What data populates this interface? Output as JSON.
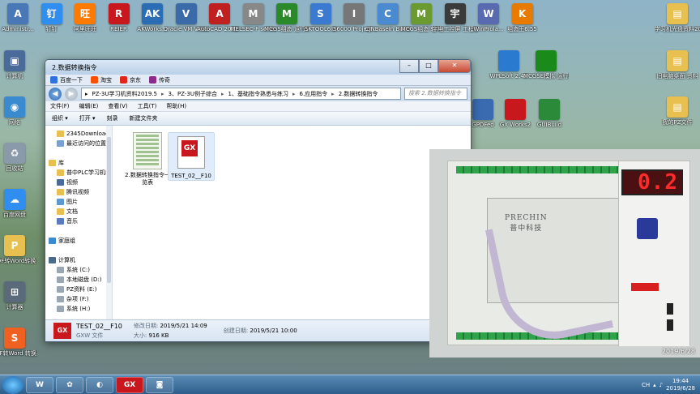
{
  "desktop_icons": [
    {
      "label": "Administr...",
      "col": 0,
      "color": "#4a77b5",
      "glyph": "A"
    },
    {
      "label": "钉钉",
      "col": 1,
      "color": "#2f8ef0",
      "glyph": "钉"
    },
    {
      "label": "阿里旺旺",
      "col": 2,
      "color": "#ff7a00",
      "glyph": "旺"
    },
    {
      "label": "REIER",
      "col": 3,
      "color": "#c8171d",
      "glyph": "R"
    },
    {
      "label": "AKWorks...",
      "col": 4,
      "color": "#2a6db5",
      "glyph": "AK"
    },
    {
      "label": "Oracle VM VirtualBox",
      "col": 5,
      "color": "#3a6aa8",
      "glyph": "V"
    },
    {
      "label": "AutoCAD 2012 - S...",
      "col": 6,
      "color": "#c02020",
      "glyph": "A"
    },
    {
      "label": "MELSEC-F series 串口...",
      "col": 7,
      "color": "#888",
      "glyph": "M"
    },
    {
      "label": "MCGS组态 运行环境",
      "col": 8,
      "color": "#2a8a2a",
      "glyph": "M"
    },
    {
      "label": "SKTOOL6.2",
      "col": 9,
      "color": "#3a7ad0",
      "glyph": "S"
    },
    {
      "label": "IS6000 Project ...",
      "col": 10,
      "color": "#777",
      "glyph": "I"
    },
    {
      "label": "CJNBaseIn Builder 3.00",
      "col": 11,
      "color": "#4a8ad0",
      "glyph": "C"
    },
    {
      "label": "MCGS组态 软件",
      "col": 12,
      "color": "#6a9a30",
      "glyph": "M"
    },
    {
      "label": "宇电工控屏 工程设计",
      "col": 13,
      "color": "#3a3a3a",
      "glyph": "宇"
    },
    {
      "label": "WinProla...",
      "col": 14,
      "color": "#5a6ab0",
      "glyph": "W"
    },
    {
      "label": "组态王6.55",
      "col": 15,
      "color": "#e87a00",
      "glyph": "K"
    },
    {
      "label": "学习机光盘资料2017.12",
      "col": 16,
      "color": "#e8c050",
      "glyph": "▤"
    }
  ],
  "window": {
    "title": "2.数据转换指令",
    "favorites": [
      {
        "label": "百度一下",
        "color": "#3070e0"
      },
      {
        "label": "淘宝",
        "color": "#ff5000"
      },
      {
        "label": "京东",
        "color": "#e1251b"
      },
      {
        "label": "传奇",
        "color": "#8a2a8a"
      }
    ],
    "breadcrumb": [
      "PZ-3U学习机资料2019.5",
      "3、PZ-3U例子综合",
      "1、基础指令熟悉与练习",
      "6.应用指令",
      "2.数据转换指令"
    ],
    "search_placeholder": "搜索 2.数据转换指令",
    "menu": [
      "文件(F)",
      "编辑(E)",
      "查看(V)",
      "工具(T)",
      "帮助(H)"
    ],
    "toolbar": [
      "组织 ▾",
      "打开 ▾",
      "刻录",
      "新建文件夹"
    ],
    "nav_items": [
      {
        "label": "2345Download",
        "color": "#e8c050"
      },
      {
        "label": "最近访问的位置",
        "color": "#7aa0d0"
      },
      {
        "label": "",
        "color": ""
      },
      {
        "label": "库",
        "color": "#e8c050"
      },
      {
        "label": "普中PLC学习机P",
        "color": "#e8c050"
      },
      {
        "label": "视频",
        "color": "#4a6a9a"
      },
      {
        "label": "腾讯视频",
        "color": "#e8c050"
      },
      {
        "label": "图片",
        "color": "#5a9ad0"
      },
      {
        "label": "文档",
        "color": "#e8c050"
      },
      {
        "label": "音乐",
        "color": "#5a7ac0"
      },
      {
        "label": "",
        "color": ""
      },
      {
        "label": "家庭组",
        "color": "#3a8ad0"
      },
      {
        "label": "",
        "color": ""
      },
      {
        "label": "计算机",
        "color": "#4a6a8a"
      },
      {
        "label": "系统 (C:)",
        "color": "#9aa6b2"
      },
      {
        "label": "本地磁盘 (D:)",
        "color": "#9aa6b2"
      },
      {
        "label": "PZ资料 (E:)",
        "color": "#9aa6b2"
      },
      {
        "label": "杂项 (F:)",
        "color": "#9aa6b2"
      },
      {
        "label": "系统 (H:)",
        "color": "#9aa6b2"
      }
    ],
    "files": [
      {
        "name": "2.数据转换指令一览表",
        "type": "sheet"
      },
      {
        "name": "TEST_02__F10",
        "type": "gxw"
      }
    ],
    "details": {
      "name": "TEST_02__F10",
      "type": "GXW 文件",
      "modified_label": "修改日期:",
      "modified": "2019/5/21 14:09",
      "size_label": "大小:",
      "size": "916 KB",
      "created_label": "创建日期:",
      "created": "2019/5/21 10:00"
    }
  },
  "left_icons": [
    {
      "label": "计算机",
      "color": "#4a6a9a",
      "glyph": "▣"
    },
    {
      "label": "网络",
      "color": "#3a8ad0",
      "glyph": "◉"
    },
    {
      "label": "回收站",
      "color": "#8a9aaa",
      "glyph": "♻"
    },
    {
      "label": "百度网盘",
      "color": "#2f8ef0",
      "glyph": "☁"
    },
    {
      "label": "PDF转Word转换",
      "color": "#e8c050",
      "glyph": "P"
    },
    {
      "label": "计算器",
      "color": "#5a6a7a",
      "glyph": "⊞"
    },
    {
      "label": "PDF转Word 转换器V6.2",
      "color": "#f06020",
      "glyph": "S"
    }
  ],
  "right_icons": [
    {
      "label": "旧电脑桌面 资料",
      "color": "#e8c050",
      "glyph": "▤"
    },
    {
      "label": "我的PZ文件",
      "color": "#e8c050",
      "glyph": "▤"
    }
  ],
  "mid_icons": [
    {
      "label": "WPLSoft 2.45",
      "color": "#2a7ad0"
    },
    {
      "label": "MCGSE模拟 运行环境",
      "color": "#1a8a1a"
    },
    {
      "label": "GUIBuild",
      "color": "#2a8a3a"
    },
    {
      "label": "GX Works2",
      "color": "#c8171d"
    },
    {
      "label": "GPDFed",
      "color": "#3a6ab0"
    }
  ],
  "camera": {
    "display": "0.2",
    "brand": "PRECHIN",
    "brand_cn": "普中科技",
    "timestamp": "2019/6/28"
  },
  "taskbar": {
    "apps": [
      "W",
      "✿",
      "◐",
      "GX",
      "◙"
    ],
    "time": "19:44",
    "date": "2019/6/28",
    "lang": "CH"
  }
}
